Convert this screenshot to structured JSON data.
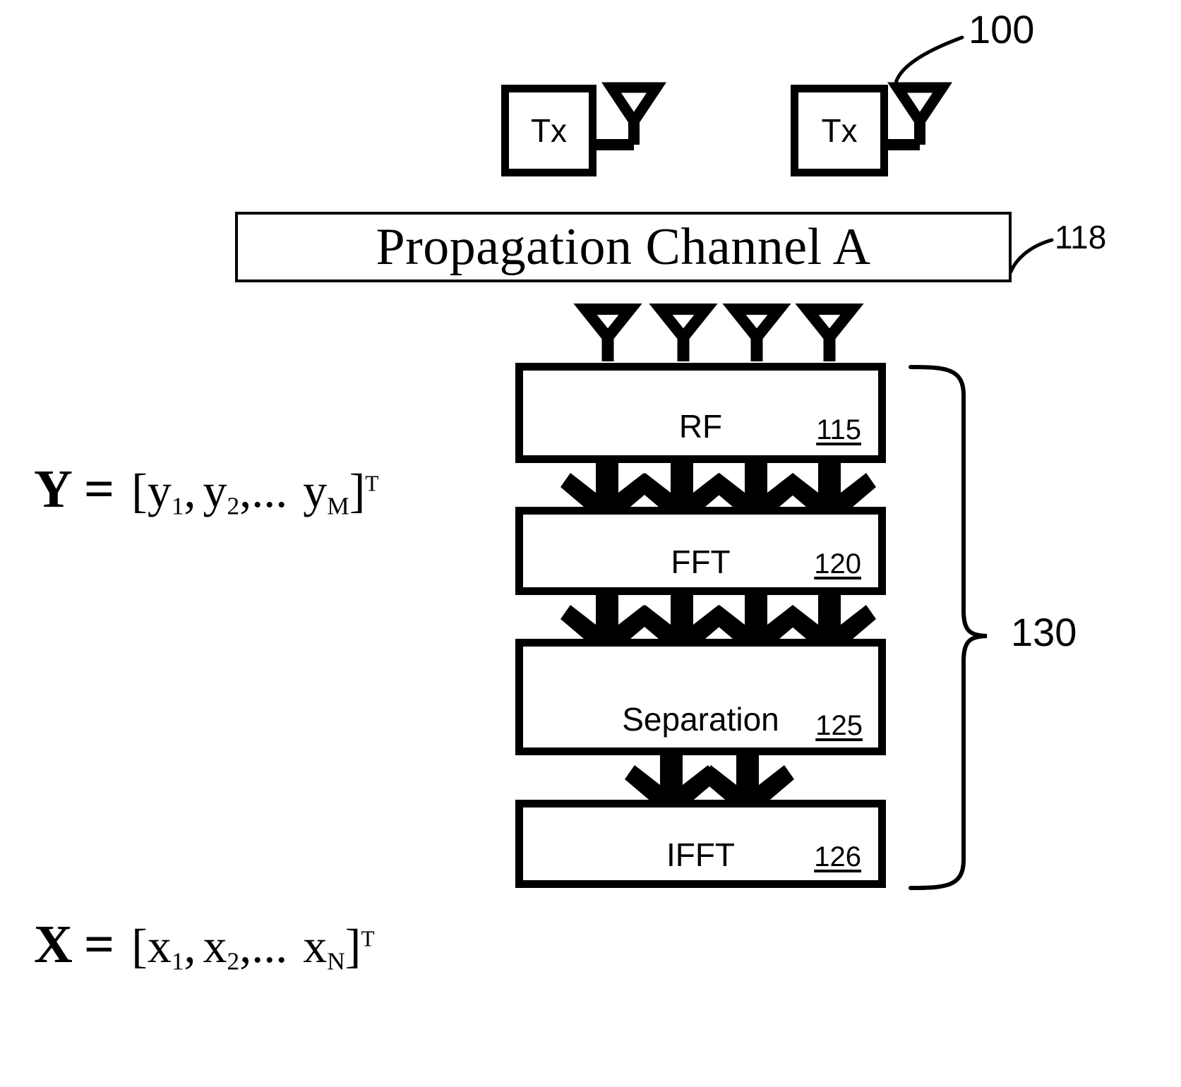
{
  "figure": {
    "transmitters": [
      {
        "label": "Tx"
      },
      {
        "label": "Tx"
      }
    ],
    "channel": {
      "label": "Propagation Channel A",
      "ref": "118"
    },
    "system_ref": "100",
    "receiver_ref": "130",
    "blocks": [
      {
        "label": "RF",
        "ref": "115"
      },
      {
        "label": "FFT",
        "ref": "120"
      },
      {
        "label": "Separation",
        "ref": "125"
      },
      {
        "label": "IFFT",
        "ref": "126"
      }
    ],
    "equations": {
      "received": {
        "vector": "Y",
        "equals": "=",
        "open": "[",
        "e1": "y",
        "e1sub": "1",
        "sep1": ",",
        "e2": "y",
        "e2sub": "2",
        "ellipsis": ",...",
        "e3": "y",
        "e3sub": "M",
        "close": "]",
        "transpose": "T"
      },
      "transmitted": {
        "vector": "X",
        "equals": "=",
        "open": "[",
        "e1": "x",
        "e1sub": "1",
        "sep1": ",",
        "e2": "x",
        "e2sub": "2",
        "ellipsis": ",...",
        "e3": "x",
        "e3sub": "N",
        "close": "]",
        "transpose": "T"
      }
    },
    "colors": {
      "ink": "#000000",
      "paper": "#ffffff"
    }
  }
}
